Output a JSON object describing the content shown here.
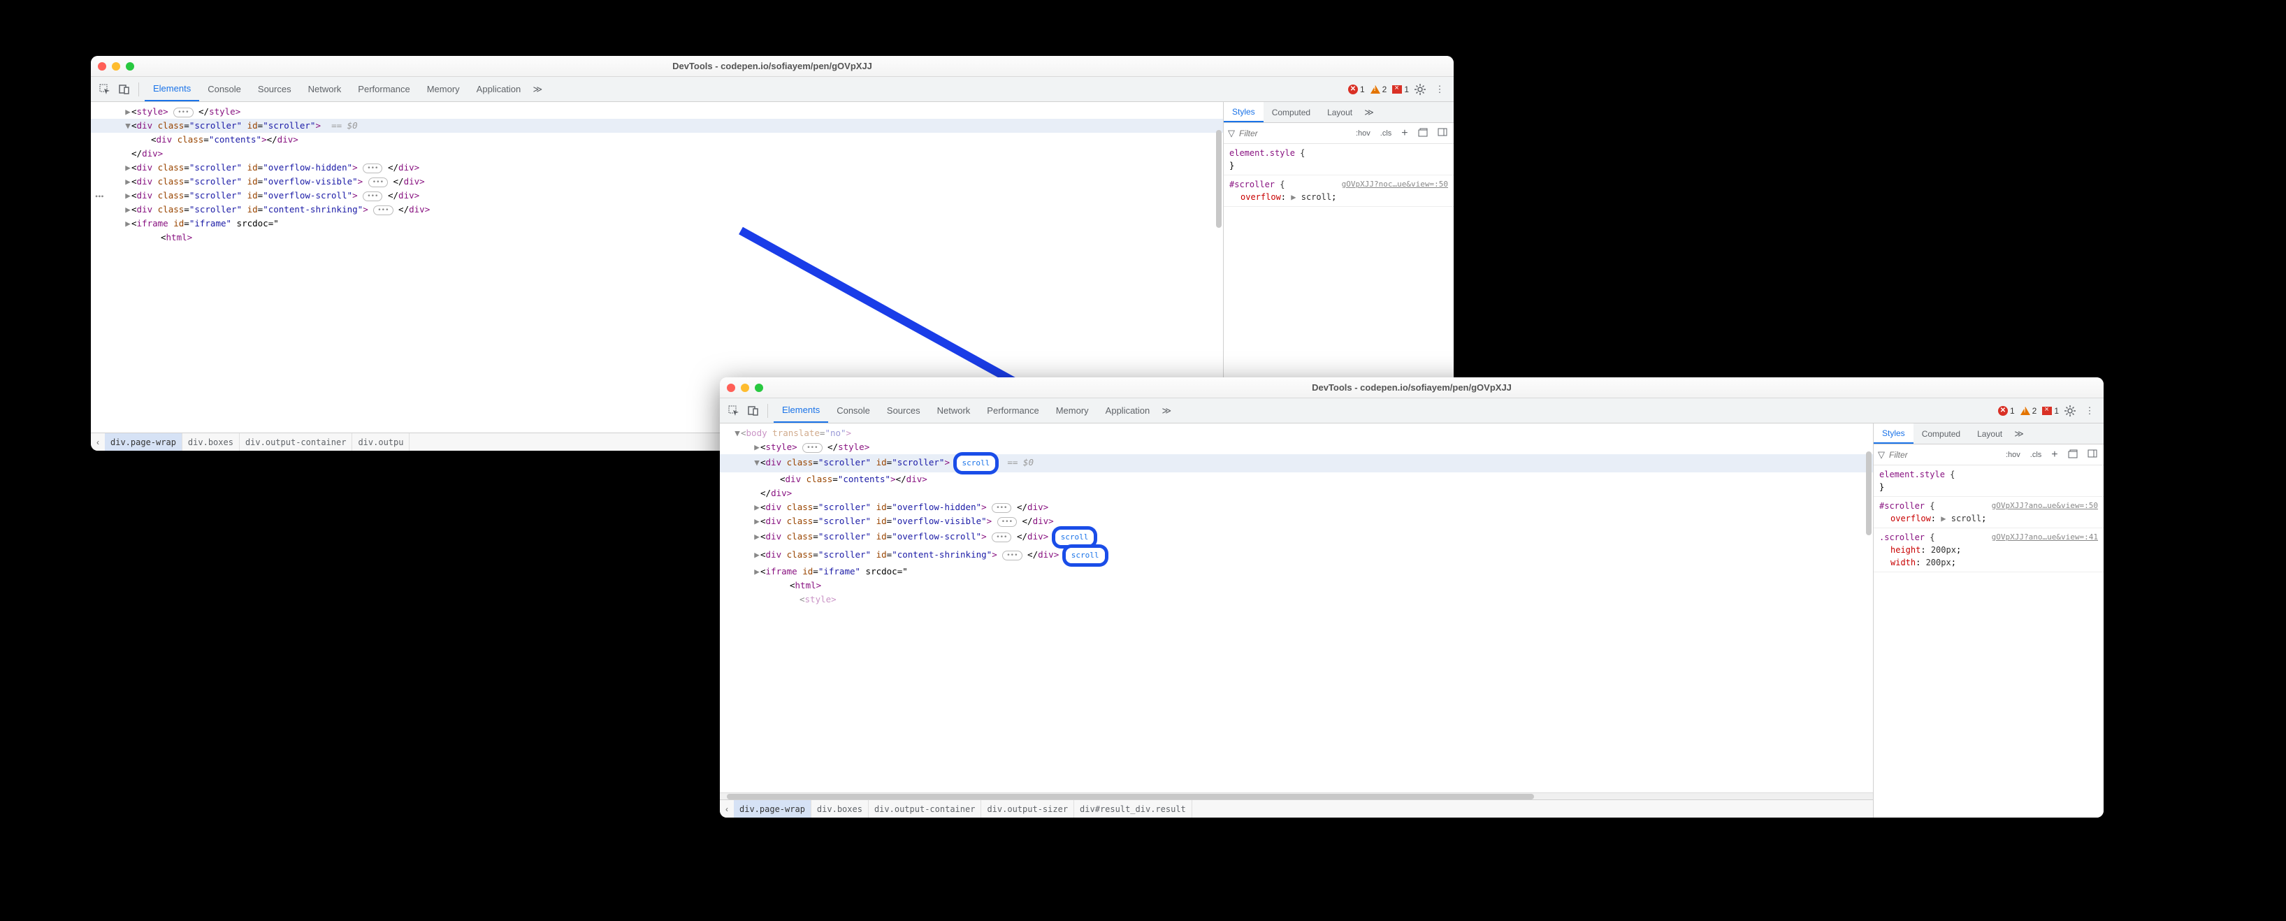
{
  "windows": [
    {
      "title": "DevTools - codepen.io/sofiayem/pen/gOVpXJJ",
      "tabs": [
        "Elements",
        "Console",
        "Sources",
        "Network",
        "Performance",
        "Memory",
        "Application"
      ],
      "activeTab": "Elements",
      "errors": "1",
      "warnings": "2",
      "issues": "1",
      "subTabs": [
        "Styles",
        "Computed",
        "Layout"
      ],
      "activeSubTab": "Styles",
      "filterPlaceholder": "Filter",
      "hov": ":hov",
      "cls": ".cls",
      "rules": [
        {
          "selector": "element.style",
          "src": "",
          "open": "{",
          "close": "}",
          "props": []
        },
        {
          "selector": "#scroller",
          "src": "gOVpXJJ?noc…ue&view=:50",
          "open": "{",
          "close": "",
          "props": [
            {
              "n": "overflow",
              "v": "scroll",
              "caret": true
            }
          ]
        }
      ],
      "dom": [
        {
          "indent": 3,
          "arrow": "▶",
          "raw": "<style>",
          "trail": "</style>",
          "dots": true
        },
        {
          "indent": 3,
          "arrow": "▼",
          "sel": true,
          "raw": "<div class=\"scroller\" id=\"scroller\">",
          "eqvar": "== $0"
        },
        {
          "indent": 5,
          "raw": "<div class=\"contents\"></div>"
        },
        {
          "indent": 3,
          "raw": "</div>"
        },
        {
          "indent": 3,
          "arrow": "▶",
          "raw": "<div class=\"scroller\" id=\"overflow-hidden\">",
          "dots": true,
          "trail": "</div>"
        },
        {
          "indent": 3,
          "arrow": "▶",
          "raw": "<div class=\"scroller\" id=\"overflow-visible\">",
          "dots": true,
          "trail": "</div>"
        },
        {
          "indent": 3,
          "arrow": "▶",
          "raw": "<div class=\"scroller\" id=\"overflow-scroll\">",
          "dots": true,
          "trail": "</div>"
        },
        {
          "indent": 3,
          "arrow": "▶",
          "raw": "<div class=\"scroller\" id=\"content-shrinking\">",
          "dots": true,
          "trail": "</div>"
        },
        {
          "indent": 3,
          "arrow": "▶",
          "raw": "<iframe id=\"iframe\" srcdoc=\""
        },
        {
          "indent": 6,
          "raw": "<html>"
        }
      ],
      "crumbs": [
        "div.page-wrap",
        "div.boxes",
        "div.output-container",
        "div.outpu"
      ],
      "crumbSel": 0
    },
    {
      "title": "DevTools - codepen.io/sofiayem/pen/gOVpXJJ",
      "tabs": [
        "Elements",
        "Console",
        "Sources",
        "Network",
        "Performance",
        "Memory",
        "Application"
      ],
      "activeTab": "Elements",
      "errors": "1",
      "warnings": "2",
      "issues": "1",
      "subTabs": [
        "Styles",
        "Computed",
        "Layout"
      ],
      "activeSubTab": "Styles",
      "filterPlaceholder": "Filter",
      "hov": ":hov",
      "cls": ".cls",
      "rules": [
        {
          "selector": "element.style",
          "src": "",
          "open": "{",
          "close": "}",
          "props": []
        },
        {
          "selector": "#scroller",
          "src": "gOVpXJJ?ano…ue&view=:50",
          "open": "{",
          "close": "",
          "props": [
            {
              "n": "overflow",
              "v": "scroll",
              "caret": true
            }
          ]
        },
        {
          "selector": ".scroller",
          "src": "gOVpXJJ?ano…ue&view=:41",
          "open": "{",
          "close": "",
          "props": [
            {
              "n": "height",
              "v": "200px"
            },
            {
              "n": "width",
              "v": "200px"
            }
          ]
        }
      ],
      "dom": [
        {
          "indent": 1,
          "arrow": "▼",
          "faint": true,
          "raw": "<body translate=\"no\">"
        },
        {
          "indent": 3,
          "arrow": "▶",
          "raw": "<style>",
          "dots": true,
          "trail": "</style>"
        },
        {
          "indent": 3,
          "arrow": "▼",
          "sel": true,
          "raw": "<div class=\"scroller\" id=\"scroller\">",
          "badge": "scroll",
          "badgeHL": true,
          "eqvar": "== $0"
        },
        {
          "indent": 5,
          "raw": "<div class=\"contents\"></div>"
        },
        {
          "indent": 3,
          "raw": "</div>"
        },
        {
          "indent": 3,
          "arrow": "▶",
          "raw": "<div class=\"scroller\" id=\"overflow-hidden\">",
          "dots": true,
          "trail": "</div>"
        },
        {
          "indent": 3,
          "arrow": "▶",
          "raw": "<div class=\"scroller\" id=\"overflow-visible\">",
          "dots": true,
          "trail": "</div>"
        },
        {
          "indent": 3,
          "arrow": "▶",
          "raw": "<div class=\"scroller\" id=\"overflow-scroll\">",
          "dots": true,
          "trail": "</div>",
          "badge": "scroll",
          "badgeHL": true
        },
        {
          "indent": 3,
          "arrow": "▶",
          "raw": "<div class=\"scroller\" id=\"content-shrinking\">",
          "dots": true,
          "trail": "</div>",
          "badge": "scroll",
          "badgeHL": true
        },
        {
          "indent": 3,
          "arrow": "▶",
          "raw": "<iframe id=\"iframe\" srcdoc=\""
        },
        {
          "indent": 6,
          "raw": "<html>"
        },
        {
          "indent": 7,
          "faint": true,
          "raw": "<style>"
        }
      ],
      "crumbs": [
        "div.page-wrap",
        "div.boxes",
        "div.output-container",
        "div.output-sizer",
        "div#result_div.result"
      ],
      "crumbSel": 0
    }
  ]
}
